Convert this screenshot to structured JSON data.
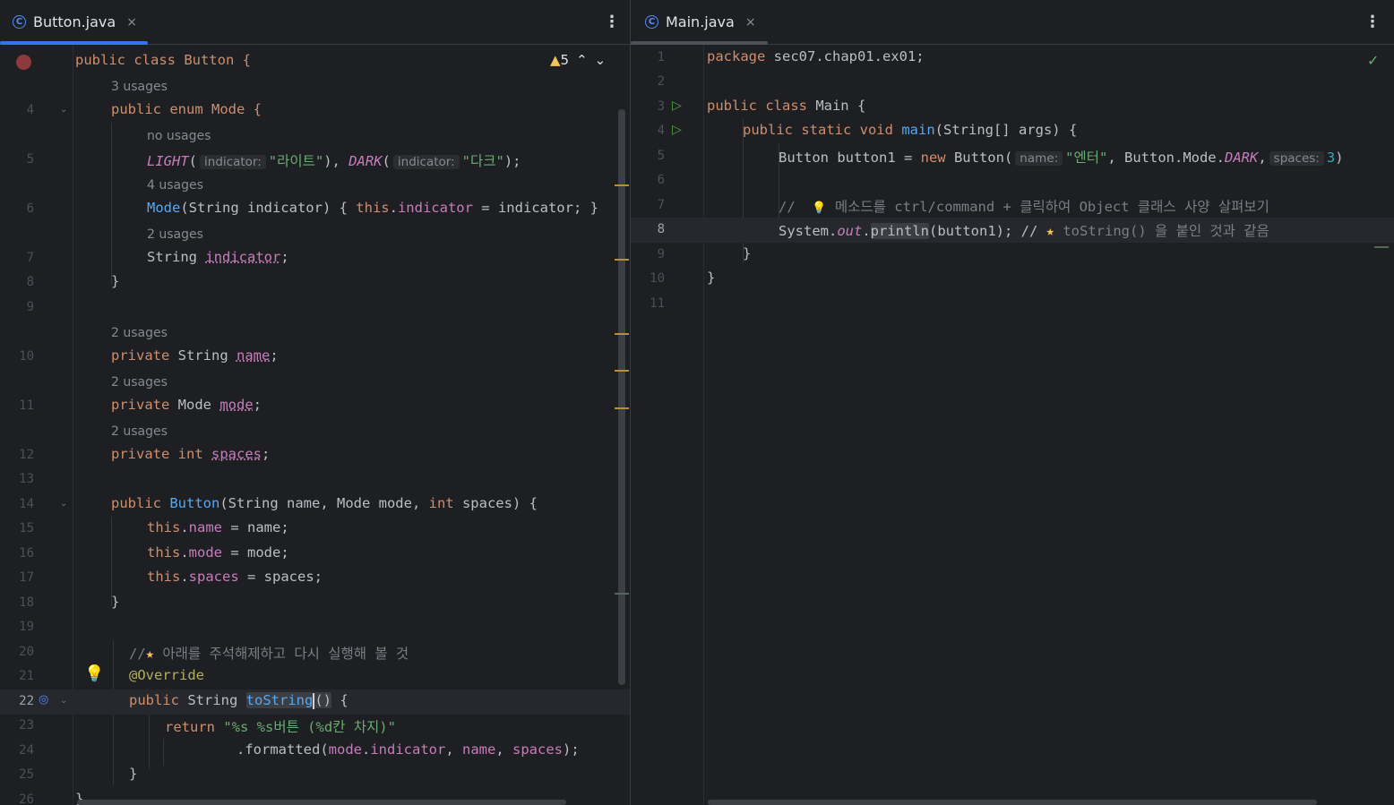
{
  "left_tab": {
    "name": "Button.java",
    "icon": "C",
    "close": "×"
  },
  "right_tab": {
    "name": "Main.java",
    "icon": "C",
    "close": "×"
  },
  "menu_glyph": "⋮",
  "warnings": {
    "count": "5",
    "icon": "warning-triangle-icon"
  },
  "left_lines": {
    "l1": "public class Button {",
    "u1": "3 usages",
    "n4": "4",
    "l4": "public enum Mode {",
    "u2": "no usages",
    "n5": "5",
    "l5_a": "LIGHT",
    "l5_h1": "indicator:",
    "l5_s1": "\"라이트\"",
    "l5_b": "DARK",
    "l5_h2": "indicator:",
    "l5_s2": "\"다크\"",
    "u3": "4 usages",
    "n6": "6",
    "l6_a": "Mode",
    "l6_b": "(String indicator) { ",
    "l6_c": "this",
    "l6_d": "indicator",
    "l6_e": " = indicator; }",
    "u4": "2 usages",
    "n7": "7",
    "l7_a": "String ",
    "l7_b": "indicator",
    "n8": "8",
    "l8": "}",
    "n9": "9",
    "u5": "2 usages",
    "n10": "10",
    "l10_a": "private",
    "l10_b": " String ",
    "l10_c": "name",
    "u6": "2 usages",
    "n11": "11",
    "l11_a": "private",
    "l11_b": " Mode ",
    "l11_c": "mode",
    "u7": "2 usages",
    "n12": "12",
    "l12_a": "private",
    "l12_b": "int",
    "l12_c": "spaces",
    "n13": "13",
    "n14": "14",
    "l14_a": "public",
    "l14_b": "Button",
    "l14_c": "(String name, Mode mode, ",
    "l14_d": "int",
    "l14_e": " spaces) {",
    "n15": "15",
    "l15_a": "this",
    "l15_b": "name",
    "l15_c": " = name;",
    "n16": "16",
    "l16_a": "this",
    "l16_b": "mode",
    "l16_c": " = mode;",
    "n17": "17",
    "l17_a": "this",
    "l17_b": "spaces",
    "l17_c": " = spaces;",
    "n18": "18",
    "l18": "}",
    "n19": "19",
    "n20": "20",
    "l20_a": "//",
    "l20_b": " 아래를 주석해제하고 다시 실행해 볼 것",
    "n21": "21",
    "l21": "@Override",
    "n22": "22",
    "l22_a": "public",
    "l22_b": " String ",
    "l22_c": "toString",
    "l22_d": "()",
    "l22_e": " {",
    "n23": "23",
    "l23_a": "return",
    "l23_b": "\"%s %s버튼 (%d칸 차지)\"",
    "n24": "24",
    "l24_a": ".formatted(",
    "l24_b": "mode",
    "l24_c": "indicator",
    "l24_d": "name",
    "l24_e": "spaces",
    "l24_f": ");",
    "n25": "25",
    "l25": "}",
    "n26": "26",
    "l26": "}"
  },
  "right_lines": {
    "n1": "1",
    "l1_a": "package",
    "l1_b": " sec07.chap01.ex01;",
    "n2": "2",
    "n3": "3",
    "l3_a": "public class",
    "l3_b": " Main {",
    "n4": "4",
    "l4_a": "public static void",
    "l4_b": "main",
    "l4_c": "(String[] args) {",
    "n5": "5",
    "l5_a": "Button button1 = ",
    "l5_b": "new",
    "l5_c": " Button(",
    "l5_h1": "name:",
    "l5_s1": "\"엔터\"",
    "l5_d": ", Button.Mode.",
    "l5_e": "DARK",
    "l5_f": ",",
    "l5_h2": "spaces:",
    "l5_g": "3",
    "n6": "6",
    "n7": "7",
    "l7_a": "//",
    "l7_b": " 메소드를 ctrl/command + 클릭하여 Object 클래스 사양 살펴보기",
    "n8": "8",
    "l8_a": "System.",
    "l8_b": "out",
    "l8_c": ".",
    "l8_d": "println",
    "l8_e": "(button1); // ",
    "l8_f": " toString() 을 붙인 것과 같음",
    "n9": "9",
    "l9": "}",
    "n10": "10",
    "l10": "}",
    "n11": "11"
  },
  "colors": {
    "keyword": "#cf8e6d",
    "function": "#56a8f5",
    "field": "#c77dbb",
    "string": "#6aab73",
    "comment": "#7a7e85",
    "annotation": "#b3ae60",
    "accent": "#3574f0"
  }
}
